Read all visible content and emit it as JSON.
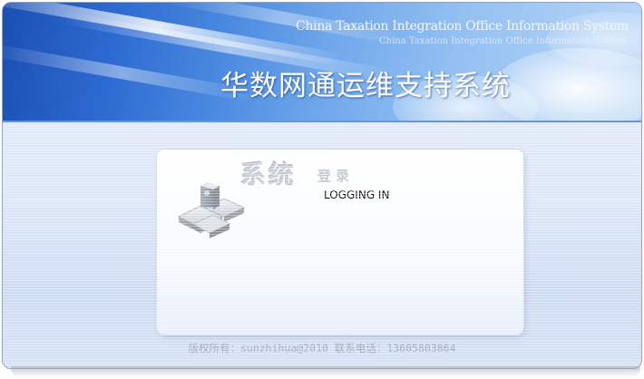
{
  "banner": {
    "subtitle_en_1": "China Taxation Integration Office Information System",
    "subtitle_en_2": "China Taxation Integration Office Information System",
    "title": "华数网通运维支持系统"
  },
  "login_panel": {
    "title_big": "系统",
    "title_small": "登录",
    "label": "LOGGING IN"
  },
  "footer": {
    "copyright": "版权所有：sunzhihua@2010 联系电话：13605803864"
  },
  "colors": {
    "banner_blue": "#2e6bd1",
    "background": "#dbe6f7",
    "footer_text": "#a2a8b4"
  },
  "icons": {
    "login": "grey-block-structure-icon"
  }
}
